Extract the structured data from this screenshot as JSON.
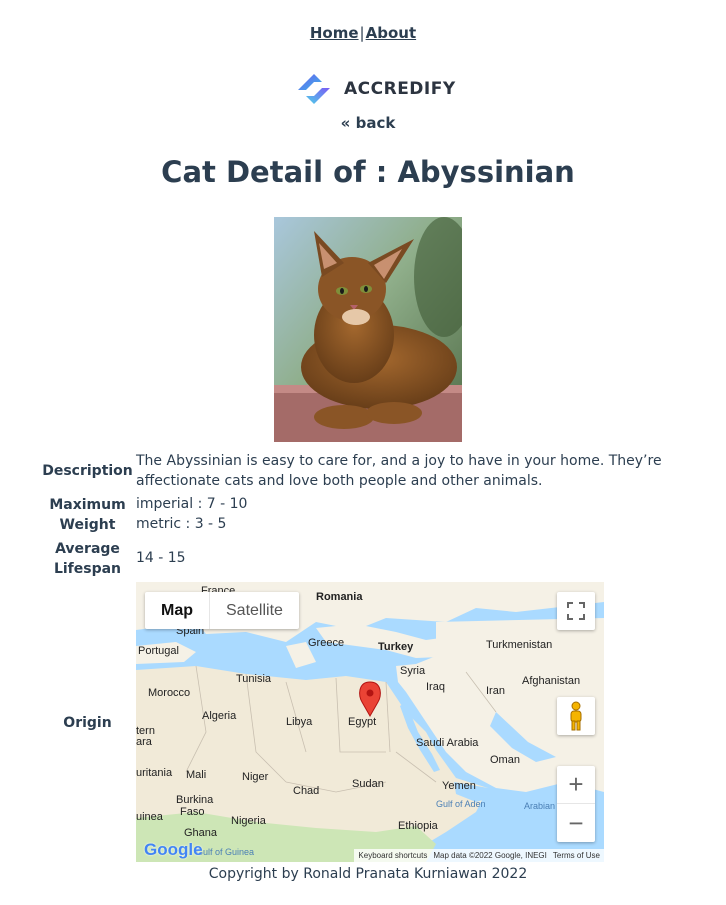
{
  "nav": {
    "home_label": "Home",
    "separator": "|",
    "about_label": "About"
  },
  "logo": {
    "text": "ACCREDIFY"
  },
  "back_label": "« back",
  "page_title": "Cat Detail of : Abyssinian",
  "details": {
    "description_label": "Description",
    "description_value": "The Abyssinian is easy to care for, and a joy to have in your home. They’re affectionate cats and love both people and other animals.",
    "weight_label_1": "Maximum",
    "weight_label_2": "Weight",
    "weight_imperial": "imperial : 7 - 10",
    "weight_metric": "metric : 3 - 5",
    "lifespan_label_1": "Average",
    "lifespan_label_2": "Lifespan",
    "lifespan_value": "14 - 15",
    "origin_label": "Origin"
  },
  "map": {
    "type_map": "Map",
    "type_satellite": "Satellite",
    "zoom_in": "+",
    "zoom_out": "−",
    "logo_text": "Google",
    "attribution": [
      "Keyboard shortcuts",
      "Map data ©2022 Google, INEGI",
      "Terms of Use"
    ],
    "labels": {
      "france": "France",
      "romania": "Romania",
      "spain": "Spain",
      "portugal": "Portugal",
      "greece": "Greece",
      "turkey": "Turkey",
      "turkmenistan": "Turkmenistan",
      "syria": "Syria",
      "tunisia": "Tunisia",
      "iraq": "Iraq",
      "morocco": "Morocco",
      "iran": "Iran",
      "afghanistan": "Afghanistan",
      "algeria": "Algeria",
      "libya": "Libya",
      "egypt": "Egypt",
      "western": "tern",
      "sahara": "ara",
      "saudi_arabia": "Saudi Arabia",
      "oman": "Oman",
      "mauritania": "uritania",
      "mali": "Mali",
      "niger": "Niger",
      "chad": "Chad",
      "sudan": "Sudan",
      "yemen": "Yemen",
      "burkina": "Burkina",
      "faso": "Faso",
      "guinea": "uinea",
      "nigeria": "Nigeria",
      "ethiopia": "Ethiopia",
      "ghana": "Ghana",
      "gulf_of_aden": "Gulf of Aden",
      "arabian_sea": "Arabian",
      "gulf_of_guinea": "Gulf of Guinea"
    },
    "colors": {
      "water": "#aadaff",
      "land": "#f5f1e6",
      "desert": "#f1ead8",
      "green": "#cde6b6",
      "pin": "#ea4335"
    }
  },
  "footer": "Copyright by Ronald Pranata Kurniawan 2022"
}
